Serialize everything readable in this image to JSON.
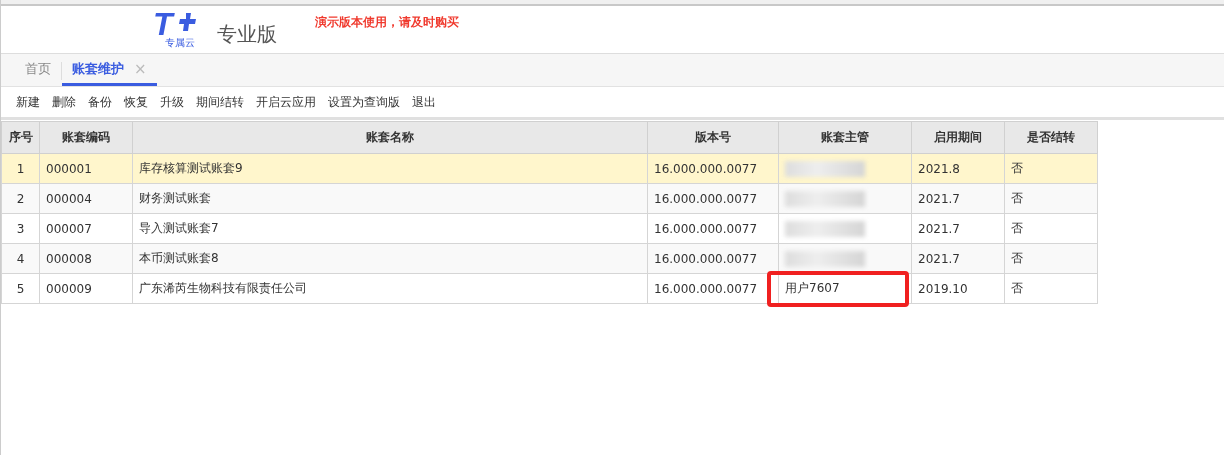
{
  "header": {
    "logo_mark": "T",
    "logo_sub": "专属云",
    "product": "专业版",
    "notice": "演示版本使用，请及时购买"
  },
  "tabs": [
    {
      "label": "首页",
      "selected": false
    },
    {
      "label": "账套维护",
      "selected": true,
      "close": "×"
    }
  ],
  "toolbar": [
    "新建",
    "删除",
    "备份",
    "恢复",
    "升级",
    "期间结转",
    "开启云应用",
    "设置为查询版",
    "退出"
  ],
  "table": {
    "columns": [
      "序号",
      "账套编码",
      "账套名称",
      "版本号",
      "账套主管",
      "启用期间",
      "是否结转"
    ],
    "rows": [
      {
        "selected": true,
        "cells": [
          "1",
          "000001",
          "库存核算测试账套9",
          "16.000.000.0077",
          "",
          "2021.8",
          "否"
        ],
        "manager_redacted": true,
        "manager_highlighted": false
      },
      {
        "selected": false,
        "cells": [
          "2",
          "000004",
          "财务测试账套",
          "16.000.000.0077",
          "",
          "2021.7",
          "否"
        ],
        "manager_redacted": true,
        "manager_highlighted": false
      },
      {
        "selected": false,
        "cells": [
          "3",
          "000007",
          "导入测试账套7",
          "16.000.000.0077",
          "",
          "2021.7",
          "否"
        ],
        "manager_redacted": true,
        "manager_highlighted": false
      },
      {
        "selected": false,
        "cells": [
          "4",
          "000008",
          "本币测试账套8",
          "16.000.000.0077",
          "",
          "2021.7",
          "否"
        ],
        "manager_redacted": true,
        "manager_highlighted": false
      },
      {
        "selected": false,
        "cells": [
          "5",
          "000009",
          "广东浠芮生物科技有限责任公司",
          "16.000.000.0077",
          "用户7607",
          "2019.10",
          "否"
        ],
        "manager_redacted": false,
        "manager_highlighted": true
      }
    ]
  }
}
